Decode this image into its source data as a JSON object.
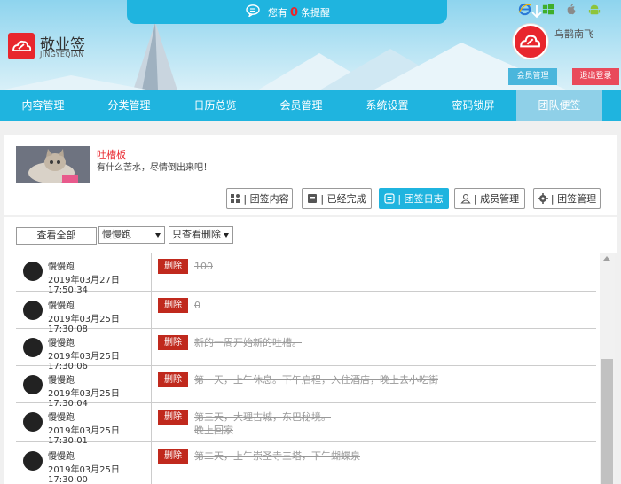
{
  "notification": {
    "prefix": "您有",
    "count": "0",
    "suffix": "条提醒"
  },
  "logo": {
    "name": "敬业签",
    "sub": "JINGYEQIAN"
  },
  "user": {
    "name": "乌鹊南飞"
  },
  "header_buttons": {
    "member": "会员管理",
    "logout": "退出登录"
  },
  "os_icons": [
    "ie-icon",
    "windows-icon",
    "apple-icon",
    "android-icon"
  ],
  "nav": {
    "items": [
      {
        "label": "内容管理"
      },
      {
        "label": "分类管理"
      },
      {
        "label": "日历总览"
      },
      {
        "label": "会员管理"
      },
      {
        "label": "系统设置"
      },
      {
        "label": "密码锁屏"
      },
      {
        "label": "团队便签"
      }
    ],
    "active_index": 6
  },
  "board": {
    "title": "吐槽板",
    "desc": "有什么苦水，尽情倒出来吧！",
    "tabs": [
      {
        "label": "| 团签内容",
        "icon": "apps-icon"
      },
      {
        "label": "| 已经完成",
        "icon": "archive-icon"
      },
      {
        "label": "| 团签日志",
        "icon": "log-icon",
        "active": true
      },
      {
        "label": "| 成员管理",
        "icon": "user-icon"
      },
      {
        "label": "| 团签管理",
        "icon": "gear-icon"
      }
    ]
  },
  "filter": {
    "view_all": "查看全部",
    "member_select": "慢慢跑",
    "type_select": "只查看删除"
  },
  "log": {
    "delete_label": "删除",
    "rows": [
      {
        "user": "慢慢跑",
        "time": "2019年03月27日 17:50:34",
        "content": "100",
        "content2": ""
      },
      {
        "user": "慢慢跑",
        "time": "2019年03月25日 17:30:08",
        "content": "0",
        "content2": ""
      },
      {
        "user": "慢慢跑",
        "time": "2019年03月25日 17:30:06",
        "content": "新的一周开始新的吐槽。",
        "content2": ""
      },
      {
        "user": "慢慢跑",
        "time": "2019年03月25日 17:30:04",
        "content": "第一天，上午休息。下午启程，入住酒店，晚上去小吃街",
        "content2": ""
      },
      {
        "user": "慢慢跑",
        "time": "2019年03月25日 17:30:01",
        "content": "第三天，大理古城，东巴秘境。",
        "content2": "晚上回家"
      },
      {
        "user": "慢慢跑",
        "time": "2019年03月25日 17:30:00",
        "content": "第二天，上午崇圣寺三塔，下午蝴蝶泉",
        "content2": ""
      }
    ]
  }
}
